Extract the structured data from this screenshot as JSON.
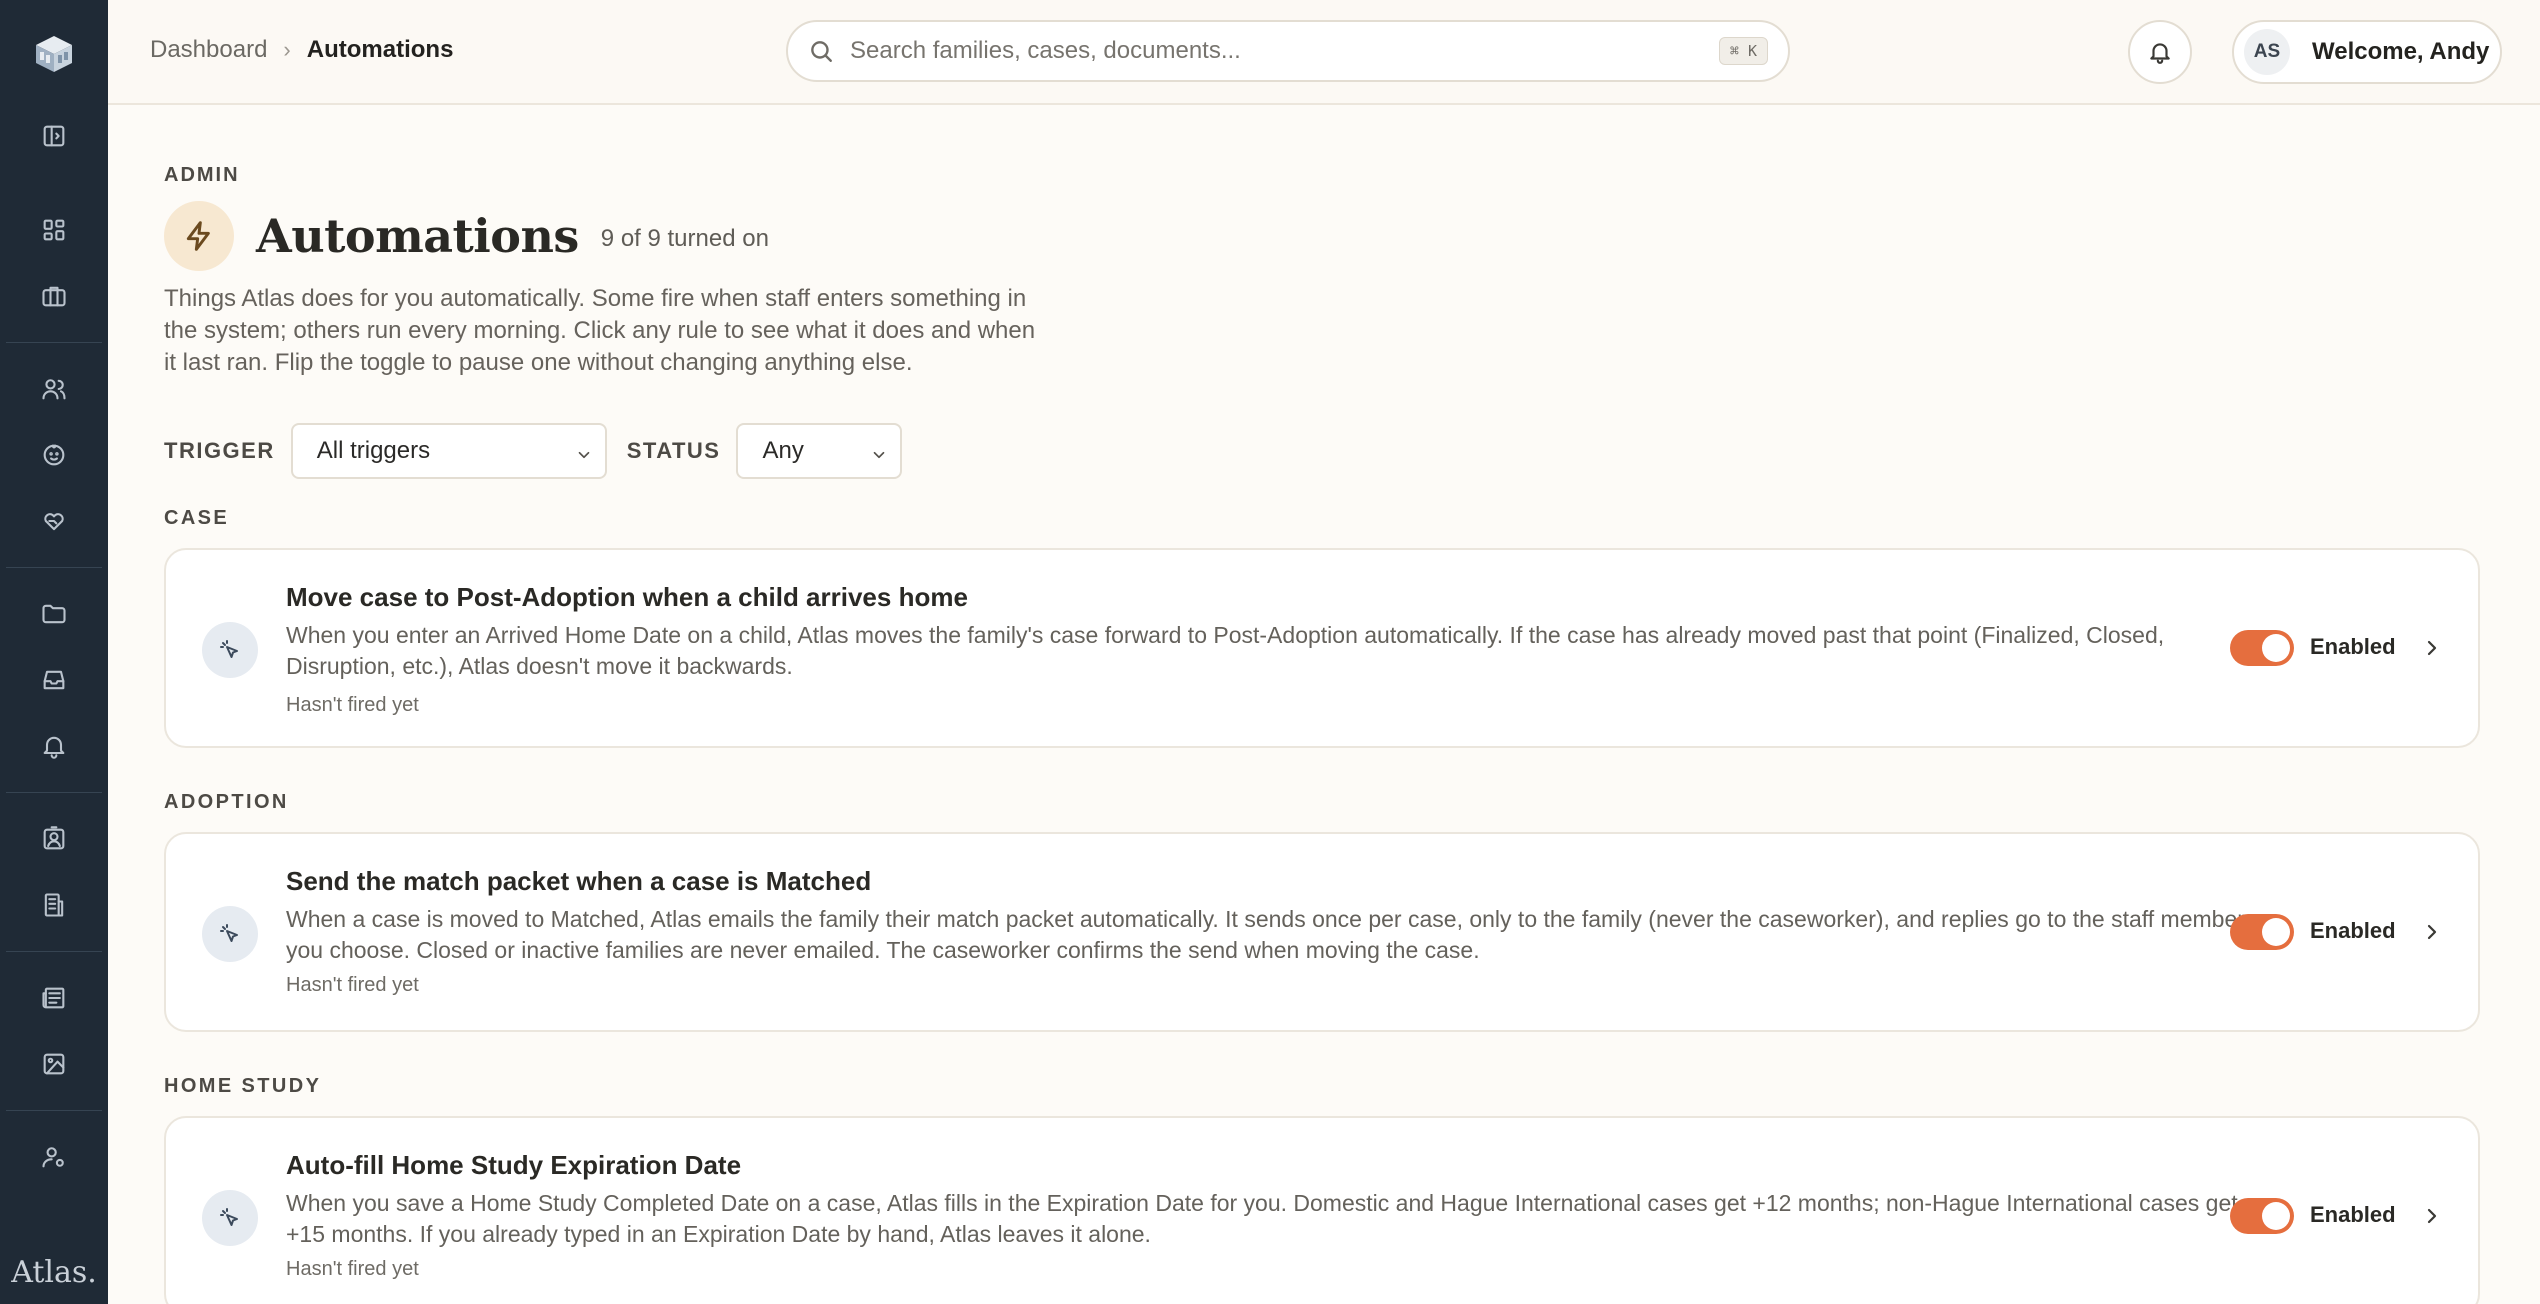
{
  "app": {
    "wordmark": "Atlas."
  },
  "breadcrumb": {
    "parent": "Dashboard",
    "separator": "›",
    "current": "Automations"
  },
  "search": {
    "placeholder": "Search families, cases, documents...",
    "shortcut": "⌘ K"
  },
  "user": {
    "initials": "AS",
    "welcome": "Welcome, Andy"
  },
  "sidebar": {
    "icons": [
      "sidebar-toggle-icon",
      "dashboard-icon",
      "briefcase-icon",
      "people-icon",
      "child-icon",
      "heart-hand-icon",
      "folder-icon",
      "inbox-icon",
      "bell-icon",
      "contact-badge-icon",
      "building-icon",
      "newspaper-icon",
      "image-icon",
      "user-settings-icon"
    ]
  },
  "page": {
    "eyebrow": "ADMIN",
    "title": "Automations",
    "count": "9 of 9 turned on",
    "intro": "Things Atlas does for you automatically. Some fire when staff enters something in the system; others run every morning. Click any rule to see what it does and when it last ran. Flip the toggle to pause one without changing anything else."
  },
  "filters": {
    "trigger_label": "TRIGGER",
    "trigger_value": "All triggers",
    "status_label": "STATUS",
    "status_value": "Any"
  },
  "sections": [
    {
      "label": "CASE",
      "rule": {
        "title": "Move case to Post-Adoption when a child arrives home",
        "description": "When you enter an Arrived Home Date on a child, Atlas moves the family's case forward to Post-Adoption automatically. If the case has already moved past that point (Finalized, Closed, Disruption, etc.), Atlas doesn't move it backwards.",
        "meta": "Hasn't fired yet",
        "status": "Enabled",
        "enabled": true
      }
    },
    {
      "label": "ADOPTION",
      "rule": {
        "title": "Send the match packet when a case is Matched",
        "description": "When a case is moved to Matched, Atlas emails the family their match packet automatically. It sends once per case, only to the family (never the caseworker), and replies go to the staff member you choose. Closed or inactive families are never emailed. The caseworker confirms the send when moving the case.",
        "meta": "Hasn't fired yet",
        "status": "Enabled",
        "enabled": true
      }
    },
    {
      "label": "HOME STUDY",
      "rule": {
        "title": "Auto-fill Home Study Expiration Date",
        "description": "When you save a Home Study Completed Date on a case, Atlas fills in the Expiration Date for you. Domestic and Hague International cases get +12 months; non-Hague International cases get +15 months. If you already typed in an Expiration Date by hand, Atlas leaves it alone.",
        "meta": "Hasn't fired yet",
        "status": "Enabled",
        "enabled": true
      }
    }
  ],
  "colors": {
    "sidebar": "#1f2a36",
    "accent": "#e56e3e",
    "background": "#fdfbf7"
  }
}
